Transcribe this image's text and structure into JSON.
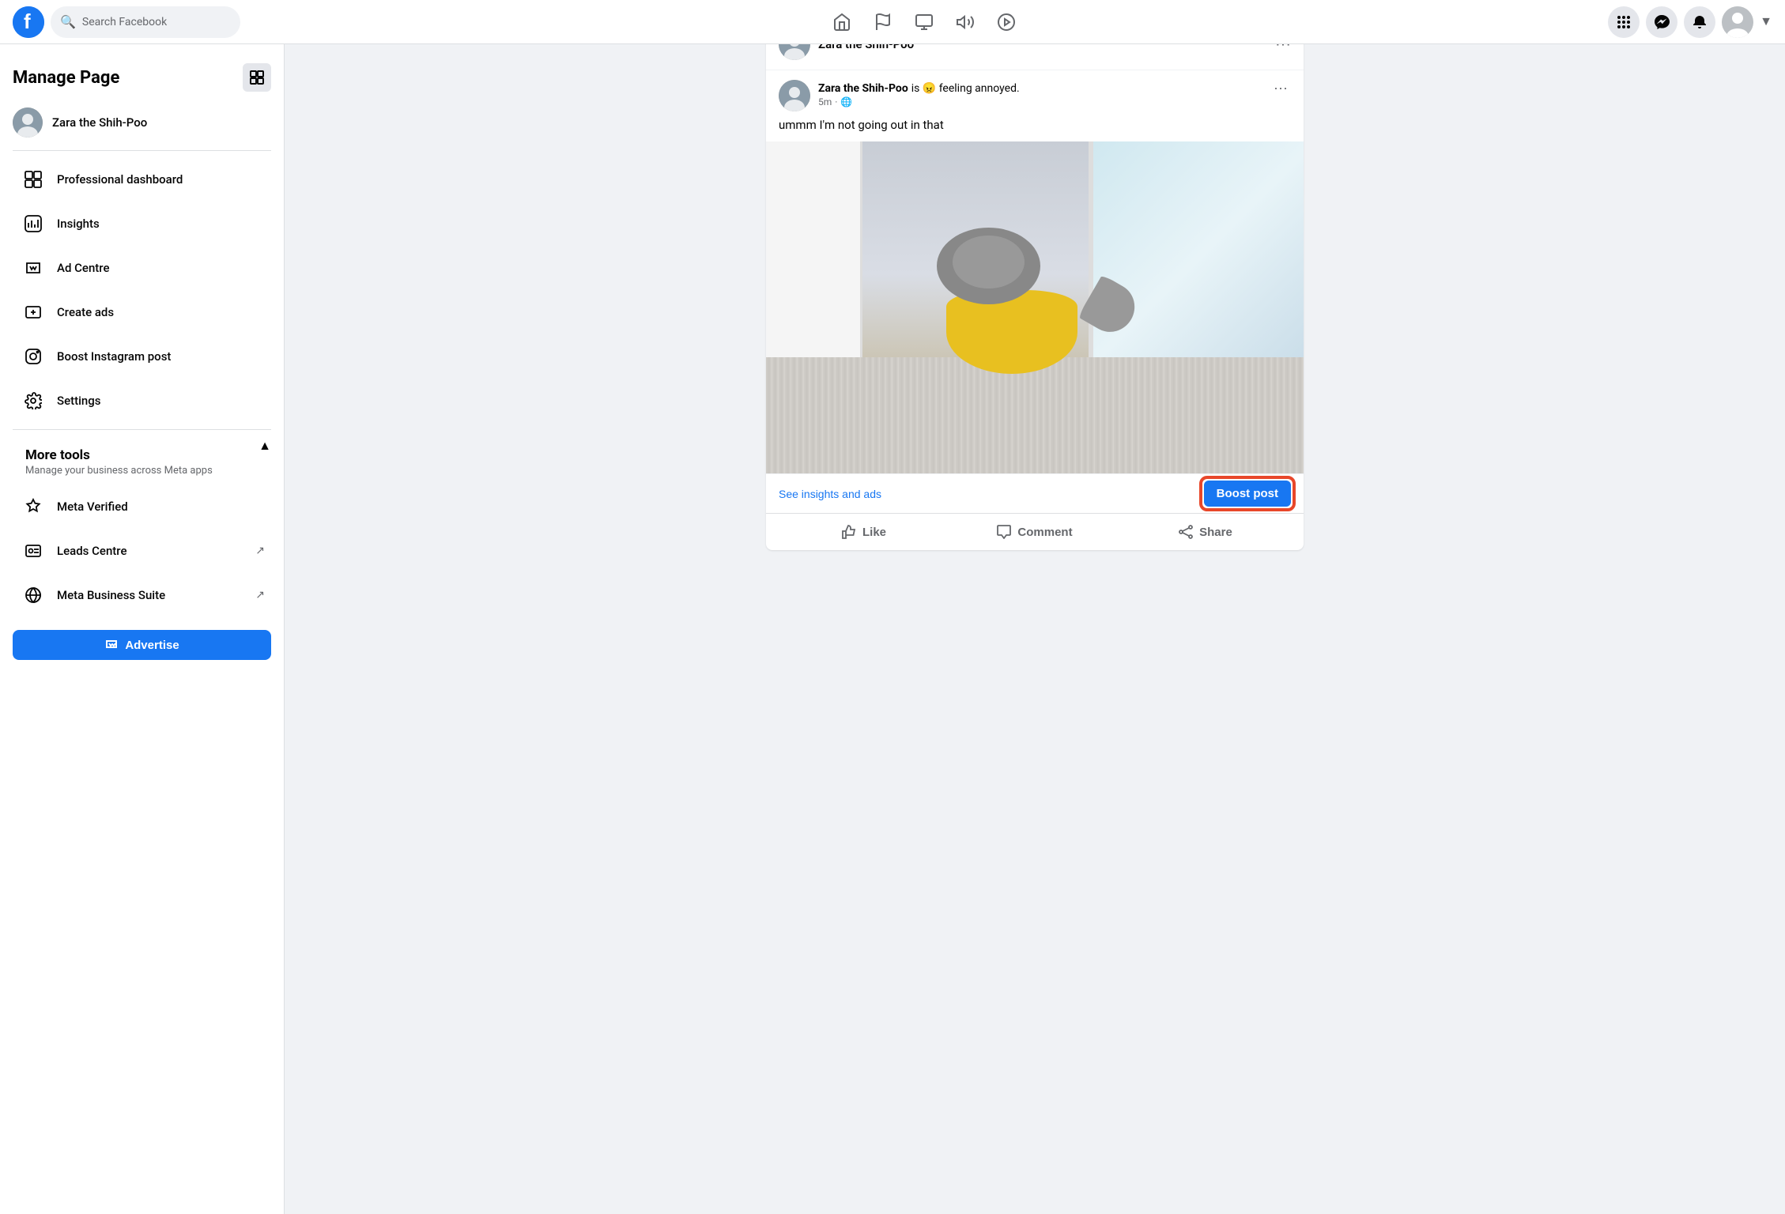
{
  "app": {
    "title": "Facebook",
    "logo_letter": "f"
  },
  "nav": {
    "search_placeholder": "Search Facebook",
    "icons": [
      "home",
      "flag",
      "chart",
      "megaphone",
      "play"
    ],
    "right_icons": [
      "grid",
      "messenger",
      "bell"
    ]
  },
  "sidebar": {
    "title": "Manage Page",
    "page_name": "Zara the Shih-Poo",
    "menu_items": [
      {
        "id": "professional-dashboard",
        "label": "Professional dashboard",
        "icon": "dashboard"
      },
      {
        "id": "insights",
        "label": "Insights",
        "icon": "insights"
      },
      {
        "id": "ad-centre",
        "label": "Ad Centre",
        "icon": "ad"
      },
      {
        "id": "create-ads",
        "label": "Create ads",
        "icon": "create-ads"
      },
      {
        "id": "boost-instagram",
        "label": "Boost Instagram post",
        "icon": "instagram"
      },
      {
        "id": "settings",
        "label": "Settings",
        "icon": "settings"
      }
    ],
    "more_tools": {
      "title": "More tools",
      "subtitle": "Manage your business across Meta apps",
      "items": [
        {
          "id": "meta-verified",
          "label": "Meta Verified",
          "icon": "verified",
          "external": false
        },
        {
          "id": "leads-centre",
          "label": "Leads Centre",
          "icon": "leads",
          "external": true
        },
        {
          "id": "meta-business-suite",
          "label": "Meta Business Suite",
          "icon": "business",
          "external": true
        }
      ]
    },
    "advertise_btn": "Advertise"
  },
  "post_card": {
    "header": {
      "page_name": "Zara the Shih-Poo",
      "more_btn": "···"
    },
    "author": {
      "name": "Zara the Shih-Poo",
      "feeling": "is 😠 feeling annoyed.",
      "time": "5m",
      "audience": "🌐"
    },
    "text": "ummm I'm not going out in that",
    "actions": {
      "see_insights": "See insights and ads",
      "boost_post": "Boost post"
    },
    "social": {
      "like": "Like",
      "comment": "Comment",
      "share": "Share"
    }
  }
}
